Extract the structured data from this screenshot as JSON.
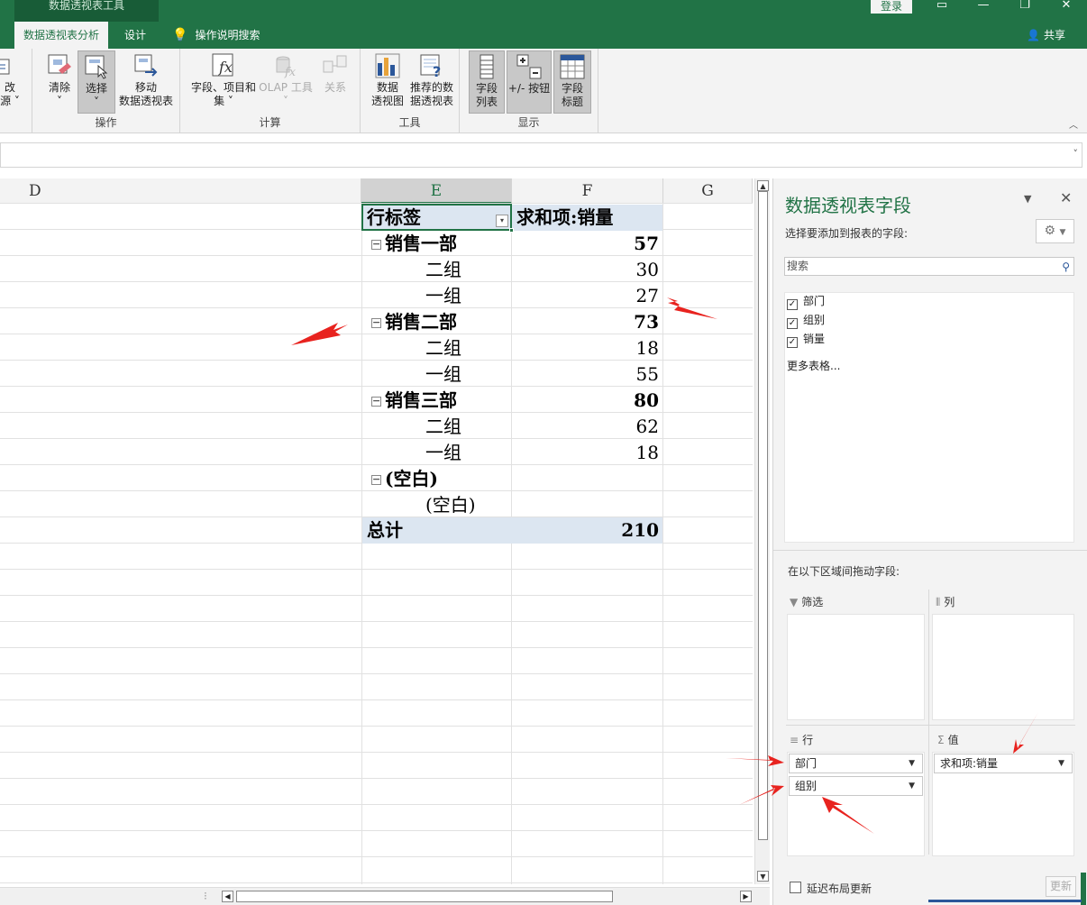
{
  "titlebar": {
    "context_tab": "数据透视表工具",
    "login": "登录"
  },
  "tabs": {
    "pivot_analyze": "数据透视表分析",
    "design": "设计",
    "tell_me": "操作说明搜索",
    "share": "共享"
  },
  "ribbon": {
    "change_source_1": "改",
    "change_source_2": "源",
    "clear": "清除",
    "select": "选择",
    "move_pivot_1": "移动",
    "move_pivot_2": "数据透视表",
    "group_actions": "操作",
    "fields_items_1": "字段、项目和",
    "fields_items_2": "集",
    "olap_tools": "OLAP 工具",
    "relationships": "关系",
    "group_calc": "计算",
    "pivot_chart_1": "数据",
    "pivot_chart_2": "透视图",
    "recommended_1": "推荐的数",
    "recommended_2": "据透视表",
    "group_tools": "工具",
    "field_list_1": "字段",
    "field_list_2": "列表",
    "buttons_label": "+/- 按钮",
    "field_headers_1": "字段",
    "field_headers_2": "标题",
    "group_show": "显示"
  },
  "grid": {
    "columns": [
      "D",
      "E",
      "F",
      "G"
    ],
    "pivot": {
      "row_labels": "行标签",
      "value_header": "求和项:销量",
      "rows": [
        {
          "label": "销售一部",
          "value": "57",
          "level": 0
        },
        {
          "label": "二组",
          "value": "30",
          "level": 1
        },
        {
          "label": "一组",
          "value": "27",
          "level": 1
        },
        {
          "label": "销售二部",
          "value": "73",
          "level": 0
        },
        {
          "label": "二组",
          "value": "18",
          "level": 1
        },
        {
          "label": "一组",
          "value": "55",
          "level": 1
        },
        {
          "label": "销售三部",
          "value": "80",
          "level": 0
        },
        {
          "label": "二组",
          "value": "62",
          "level": 1
        },
        {
          "label": "一组",
          "value": "18",
          "level": 1
        },
        {
          "label": "(空白)",
          "value": "",
          "level": 0
        },
        {
          "label": "(空白)",
          "value": "",
          "level": 1
        }
      ],
      "grand_total_label": "总计",
      "grand_total_value": "210"
    }
  },
  "pivot_pane": {
    "title": "数据透视表字段",
    "subtitle": "选择要添加到报表的字段:",
    "search_placeholder": "搜索",
    "fields": [
      {
        "name": "部门",
        "checked": true
      },
      {
        "name": "组别",
        "checked": true
      },
      {
        "name": "销量",
        "checked": true
      }
    ],
    "more_tables": "更多表格...",
    "drag_hint": "在以下区域间拖动字段:",
    "areas": {
      "filters": "筛选",
      "columns": "列",
      "rows": "行",
      "values": "值"
    },
    "row_fields": [
      "部门",
      "组别"
    ],
    "value_fields": [
      "求和项:销量"
    ],
    "defer_update": "延迟布局更新",
    "update": "更新"
  },
  "colors": {
    "accent": "#217346",
    "pivot_header_fill": "#dce6f1",
    "annotation_arrow": "#e8231f"
  }
}
